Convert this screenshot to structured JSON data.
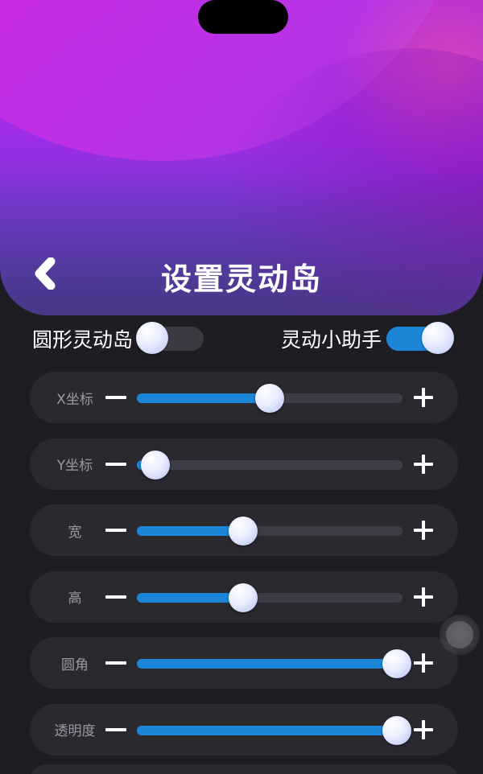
{
  "header": {
    "title": "设置灵动岛",
    "back_icon": "chevron-left-icon"
  },
  "toggles": [
    {
      "label": "圆形灵动岛",
      "state": "off"
    },
    {
      "label": "灵动小助手",
      "state": "on"
    }
  ],
  "sliders": [
    {
      "label": "X坐标",
      "value_percent": 50
    },
    {
      "label": "Y坐标",
      "value_percent": 7
    },
    {
      "label": "宽",
      "value_percent": 40
    },
    {
      "label": "高",
      "value_percent": 40
    },
    {
      "label": "圆角",
      "value_percent": 98
    },
    {
      "label": "透明度",
      "value_percent": 98
    }
  ],
  "colors": {
    "accent": "#1b86d8",
    "background": "#1e1d24",
    "row_background": "#2a2930",
    "header_gradient_top": "#e021d8",
    "header_gradient_bottom": "#4f3b9a"
  }
}
